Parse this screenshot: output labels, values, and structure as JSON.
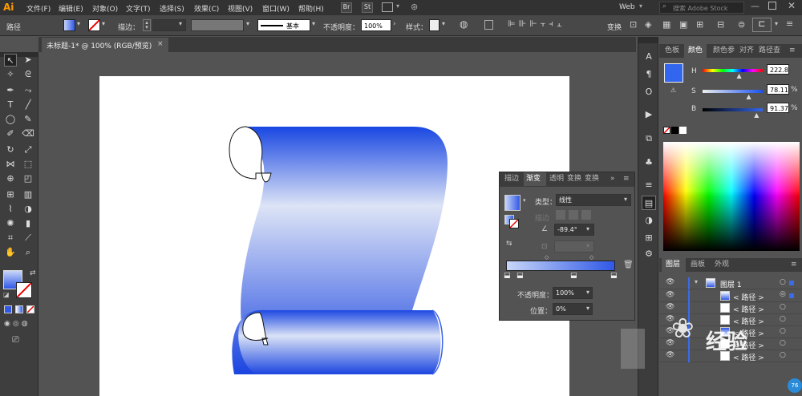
{
  "menubar": {
    "logo": "Ai",
    "items": [
      "文件(F)",
      "编辑(E)",
      "对象(O)",
      "文字(T)",
      "选择(S)",
      "效果(C)",
      "视图(V)",
      "窗口(W)",
      "帮助(H)"
    ],
    "br": "Br",
    "st": "St",
    "workspace": "Web",
    "search_placeholder": "搜索 Adobe Stock"
  },
  "control": {
    "selection_label": "路径",
    "stroke_label": "描边：",
    "stroke_style": "基本",
    "opacity_label": "不透明度：",
    "opacity_value": "100%",
    "style_label": "样式：",
    "transform_label": "变换"
  },
  "document": {
    "tab_title": "未标题-1* @ 100% (RGB/预览)",
    "close": "×"
  },
  "color_panel": {
    "tabs": [
      "色板",
      "颜色",
      "颜色参",
      "对齐",
      "路径查"
    ],
    "active_tab": "颜色",
    "h_label": "H",
    "h_value": "222.8",
    "s_label": "S",
    "s_value": "78.11",
    "b_label": "B",
    "b_value": "91.37",
    "pct": "%",
    "h_slider_level": 0.62,
    "s_slider_level": 0.78,
    "b_slider_level": 0.91,
    "swatch_color": "#3366ee"
  },
  "gradient_panel": {
    "tabs": [
      "描边",
      "渐变",
      "透明",
      "变换",
      "变换"
    ],
    "active_tab": "渐变",
    "type_label": "类型：",
    "type_value": "线性",
    "stroke_label": "描边",
    "angle_value": "-89.4°",
    "opacity_label": "不透明度：",
    "opacity_value": "100%",
    "location_label": "位置：",
    "location_value": "0%"
  },
  "layers_panel": {
    "tabs": [
      "图层",
      "画板",
      "外观"
    ],
    "layer_name": "图层 1",
    "items": [
      "< 路径 >",
      "< 路径 >",
      "< 路径 >",
      "< 路径 >",
      "< 路径 >",
      "< 路径 >"
    ]
  },
  "watermark": {
    "text": "经验",
    "badge": "76"
  },
  "colors": {
    "accent": "#1a44e0",
    "gradient_light": "#dde4f6"
  }
}
